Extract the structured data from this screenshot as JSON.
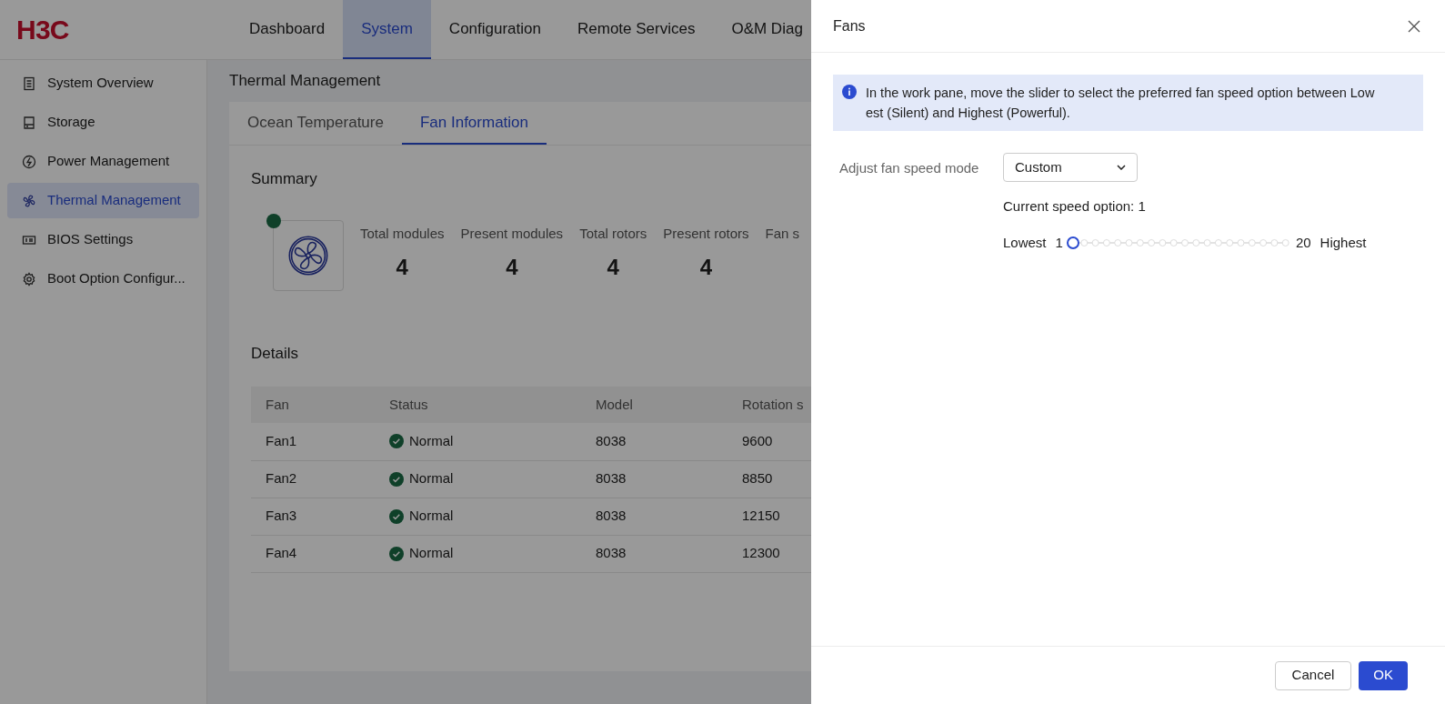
{
  "header": {
    "logo": "H3C",
    "nav": [
      {
        "label": "Dashboard",
        "selected": false
      },
      {
        "label": "System",
        "selected": true
      },
      {
        "label": "Configuration",
        "selected": false
      },
      {
        "label": "Remote Services",
        "selected": false
      },
      {
        "label": "O&M Diag",
        "selected": false
      }
    ]
  },
  "sidebar": {
    "items": [
      {
        "label": "System Overview",
        "selected": false
      },
      {
        "label": "Storage",
        "selected": false
      },
      {
        "label": "Power Management",
        "selected": false
      },
      {
        "label": "Thermal Management",
        "selected": true
      },
      {
        "label": "BIOS Settings",
        "selected": false
      },
      {
        "label": "Boot Option Configur...",
        "selected": false
      }
    ]
  },
  "page": {
    "title": "Thermal Management",
    "tabs": [
      {
        "label": "Ocean Temperature",
        "selected": false
      },
      {
        "label": "Fan Information",
        "selected": true
      }
    ],
    "summary": {
      "title": "Summary",
      "stats": [
        {
          "label": "Total modules",
          "value": "4"
        },
        {
          "label": "Present modules",
          "value": "4"
        },
        {
          "label": "Total rotors",
          "value": "4"
        },
        {
          "label": "Present rotors",
          "value": "4"
        },
        {
          "label": "Fan s"
        }
      ]
    },
    "details": {
      "title": "Details",
      "columns": [
        "Fan",
        "Status",
        "Model",
        "Rotation s"
      ],
      "rows": [
        [
          "Fan1",
          "Normal",
          "8038",
          "9600"
        ],
        [
          "Fan2",
          "Normal",
          "8038",
          "8850"
        ],
        [
          "Fan3",
          "Normal",
          "8038",
          "12150"
        ],
        [
          "Fan4",
          "Normal",
          "8038",
          "12300"
        ]
      ]
    }
  },
  "drawer": {
    "title": "Fans",
    "info": "In the work pane, move the slider to select the preferred fan speed option between Lowest (Silent) and Highest (Powerful).",
    "field": {
      "label": "Adjust fan speed mode",
      "value": "Custom"
    },
    "current": "Current speed option: 1",
    "slider": {
      "min_label": "Lowest",
      "min": "1",
      "max": "20",
      "max_label": "Highest",
      "level": 0
    },
    "buttons": [
      {
        "label": "Cancel",
        "kind": "secondary"
      },
      {
        "label": "OK",
        "kind": "primary"
      }
    ]
  }
}
